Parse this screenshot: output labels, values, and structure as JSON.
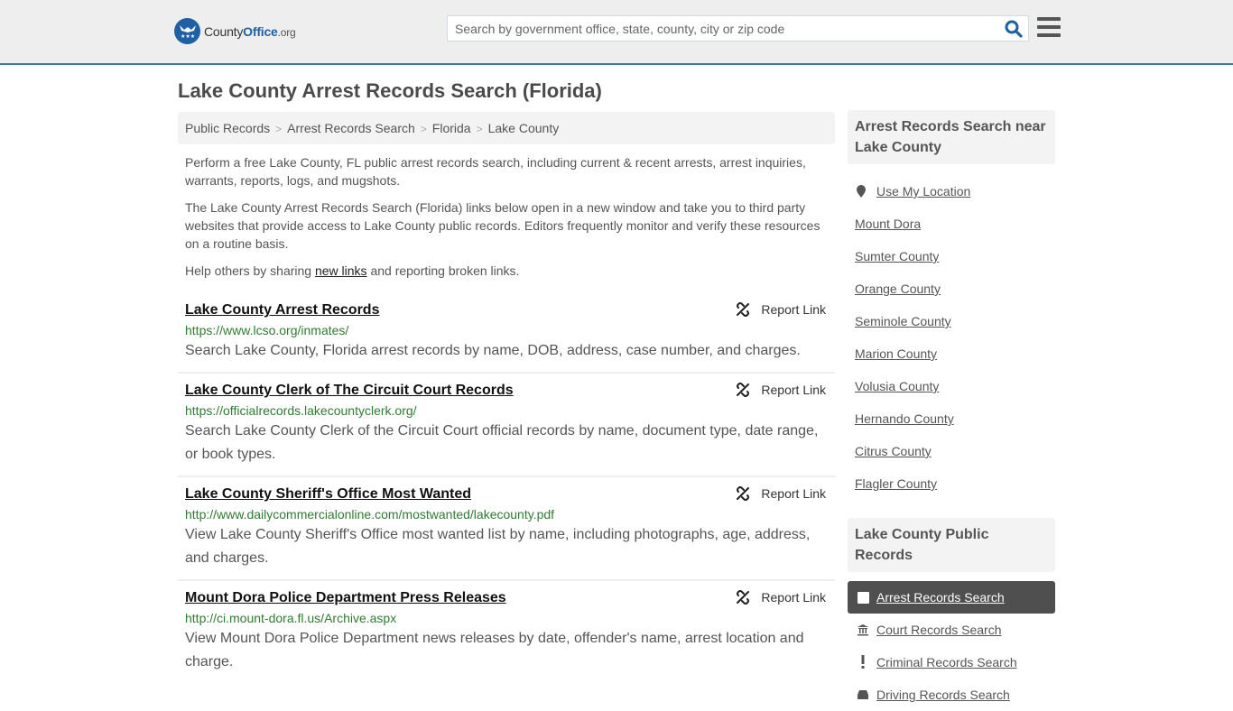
{
  "header": {
    "logo": {
      "name_part1": "County",
      "name_part2": "Office",
      "name_part3": ".org"
    },
    "search": {
      "placeholder": "Search by government office, state, county, city or zip code",
      "value": ""
    },
    "icons": {
      "search": "search-icon",
      "menu": "hamburger-menu-icon"
    }
  },
  "page": {
    "title": "Lake County Arrest Records Search (Florida)"
  },
  "breadcrumb": [
    {
      "label": "Public Records"
    },
    {
      "label": "Arrest Records Search"
    },
    {
      "label": "Florida"
    },
    {
      "label": "Lake County"
    }
  ],
  "intro": {
    "p1": "Perform a free Lake County, FL public arrest records search, including current & recent arrests, arrest inquiries, warrants, reports, logs, and mugshots.",
    "p2": "The Lake County Arrest Records Search (Florida) links below open in a new window and take you to third party websites that provide access to Lake County public records. Editors frequently monitor and verify these resources on a routine basis.",
    "p3_before": "Help others by sharing ",
    "p3_link": "new links",
    "p3_after": " and reporting broken links."
  },
  "results": [
    {
      "title": "Lake County Arrest Records",
      "url": "https://www.lcso.org/inmates/",
      "description": "Search Lake County, Florida arrest records by name, DOB, address, case number, and charges.",
      "report_label": "Report Link"
    },
    {
      "title": "Lake County Clerk of The Circuit Court Records",
      "url": "https://officialrecords.lakecountyclerk.org/",
      "description": "Search Lake County Clerk of the Circuit Court official records by name, document type, date range, or book types.",
      "report_label": "Report Link"
    },
    {
      "title": "Lake County Sheriff's Office Most Wanted",
      "url": "http://www.dailycommercialonline.com/mostwanted/lakecounty.pdf",
      "description": "View Lake County Sheriff's Office most wanted list by name, including photographs, age, address, and charges.",
      "report_label": "Report Link"
    },
    {
      "title": "Mount Dora Police Department Press Releases",
      "url": "http://ci.mount-dora.fl.us/Archive.aspx",
      "description": "View Mount Dora Police Department news releases by date, offender's name, arrest location and charge.",
      "report_label": "Report Link"
    }
  ],
  "sidebar": {
    "nearby_heading": "Arrest Records Search near Lake County",
    "use_location": "Use My Location",
    "nearby": [
      "Mount Dora",
      "Sumter County",
      "Orange County",
      "Seminole County",
      "Marion County",
      "Volusia County",
      "Hernando County",
      "Citrus County",
      "Flagler County"
    ],
    "records_heading": "Lake County Public Records",
    "records": [
      {
        "label": "Arrest Records Search",
        "icon": "square-icon",
        "active": true
      },
      {
        "label": "Court Records Search",
        "icon": "courthouse-icon",
        "active": false
      },
      {
        "label": "Criminal Records Search",
        "icon": "exclamation-icon",
        "active": false
      },
      {
        "label": "Driving Records Search",
        "icon": "car-icon",
        "active": false
      }
    ]
  },
  "colors": {
    "brand_blue": "#1f5fa3",
    "header_border": "#3b78a8",
    "url_green": "#2f7d32",
    "active_item_bg": "#4f4f4f"
  }
}
